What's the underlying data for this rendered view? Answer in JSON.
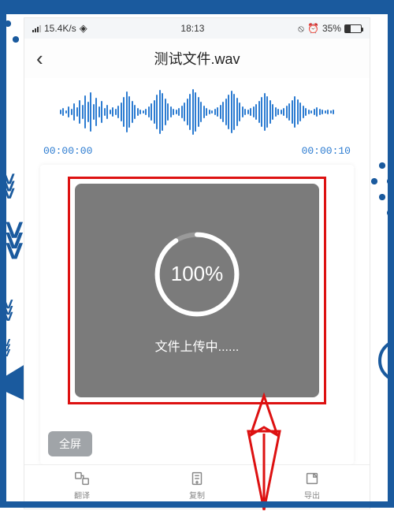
{
  "status_bar": {
    "network_speed": "15.4K/s",
    "time": "18:13",
    "battery_percent": "35%"
  },
  "nav": {
    "title": "测试文件.wav"
  },
  "player": {
    "current_time": "00:00:00",
    "duration": "00:00:10"
  },
  "upload": {
    "percent_label": "100%",
    "status_text": "文件上传中......"
  },
  "buttons": {
    "fullscreen": "全屏"
  },
  "tabs": {
    "translate": "翻译",
    "copy": "复制",
    "export": "导出"
  }
}
